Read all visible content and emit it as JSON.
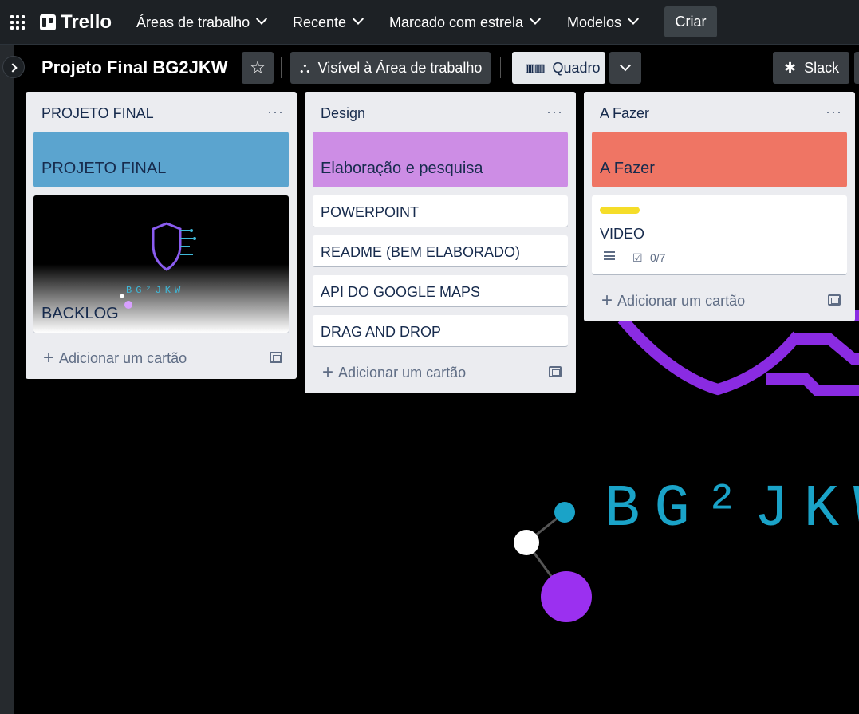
{
  "topbar": {
    "logo": "Trello",
    "nav": [
      {
        "label": "Áreas de trabalho"
      },
      {
        "label": "Recente"
      },
      {
        "label": "Marcado com estrela"
      },
      {
        "label": "Modelos"
      }
    ],
    "create_label": "Criar"
  },
  "board": {
    "title": "Projeto Final BG2JKW",
    "visibility_label": "Visível à Área de trabalho",
    "view_label": "Quadro",
    "slack_label": "Slack",
    "background_text": "BG²JKW"
  },
  "lists": [
    {
      "title": "PROJETO FINAL",
      "cover": {
        "text": "PROJETO FINAL",
        "color": "#5ba4cf"
      },
      "image_card": {
        "title": "BACKLOG",
        "image_text": "BG²JKW"
      },
      "cards": [],
      "add_label": "Adicionar um cartão"
    },
    {
      "title": "Design",
      "cover": {
        "text": "Elaboração e pesquisa",
        "color": "#cd8de5"
      },
      "cards": [
        {
          "title": "POWERPOINT"
        },
        {
          "title": "README (BEM ELABORADO)"
        },
        {
          "title": "API DO GOOGLE MAPS"
        },
        {
          "title": "DRAG AND DROP"
        }
      ],
      "add_label": "Adicionar um cartão"
    },
    {
      "title": "A Fazer",
      "cover": {
        "text": "A Fazer",
        "color": "#ef7564"
      },
      "cards": [
        {
          "title": "VIDEO",
          "label_color": "#f5dd29",
          "checklist": "0/7"
        }
      ],
      "add_label": "Adicionar um cartão"
    }
  ]
}
